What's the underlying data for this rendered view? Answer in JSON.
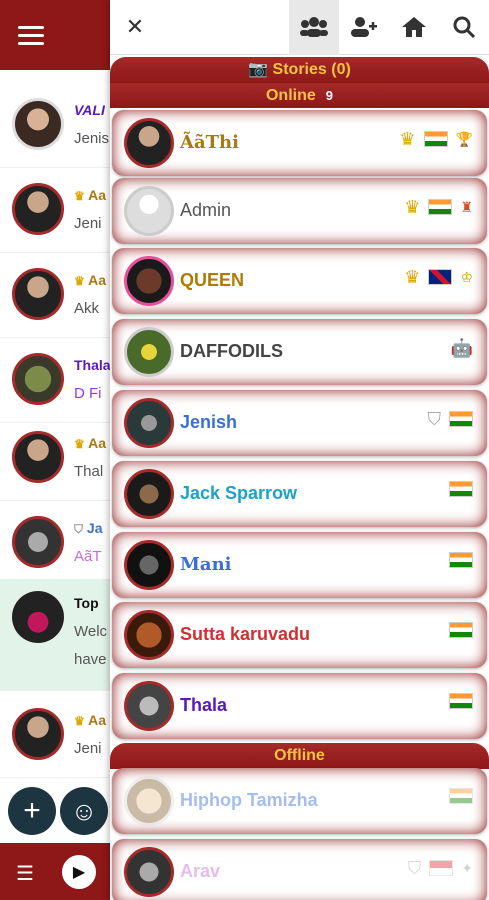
{
  "topbar": {
    "close_icon": "✕",
    "users_icon": "users-icon",
    "add_user_icon": "add-user-icon",
    "home_icon": "home-icon",
    "search_icon": "search-icon"
  },
  "sections": {
    "stories": "📷 Stories (0)",
    "online_label": "Online",
    "online_count": "9",
    "offline_label": "Offline"
  },
  "online_users": [
    {
      "name": "ÃãThi",
      "color": "#a87a12"
    },
    {
      "name": "Admin",
      "color": "#555555"
    },
    {
      "name": "QUEEN",
      "color": "#b07a00"
    },
    {
      "name": "DAFFODILS",
      "color": "#444444"
    },
    {
      "name": "Jenish",
      "color": "#3a6fd8"
    },
    {
      "name": "Jack Sparrow",
      "color": "#1aa3c8"
    },
    {
      "name": "Mani",
      "color": "#3a6fd8"
    },
    {
      "name": "Sutta karuvadu",
      "color": "#d32f2f"
    },
    {
      "name": "Thala",
      "color": "#5a1ab8"
    }
  ],
  "offline_users": [
    {
      "name": "Hiphop Tamizha",
      "color": "#3a6fd8"
    },
    {
      "name": "Arav",
      "color": "#c86bd8"
    }
  ],
  "chat_list": [
    {
      "name": "VALI",
      "msg": "Jenis"
    },
    {
      "name": "Aa",
      "msg": "Jeni"
    },
    {
      "name": "Aa",
      "msg": "Akk"
    },
    {
      "name": "Thala",
      "msg": "D Fi"
    },
    {
      "name": "Aa",
      "msg": "Thal"
    },
    {
      "name": "Ja",
      "msg": "AãT"
    },
    {
      "name": "Top",
      "msg": "Welc",
      "msg2": "have"
    },
    {
      "name": "Aa",
      "msg": "Jeni"
    }
  ],
  "colors": {
    "brand": "#8e1717",
    "gold": "#f5c242"
  }
}
